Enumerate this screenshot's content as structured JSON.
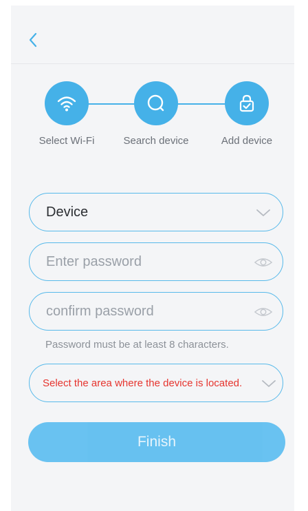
{
  "header": {
    "back_icon": "chevron-left-icon"
  },
  "steps": [
    {
      "label": "Select Wi-Fi",
      "icon": "wifi-icon"
    },
    {
      "label": "Search device",
      "icon": "search-icon"
    },
    {
      "label": "Add device",
      "icon": "lock-check-icon"
    }
  ],
  "form": {
    "device": {
      "value": "Device",
      "icon": "chevron-down-icon"
    },
    "password": {
      "placeholder": "Enter password",
      "icon": "eye-icon"
    },
    "confirm_password": {
      "placeholder": "confirm password",
      "icon": "eye-icon"
    },
    "hint": "Password must be at least 8 characters.",
    "area": {
      "placeholder": "Select the area where the device is located.",
      "icon": "chevron-down-icon"
    },
    "finish_label": "Finish"
  },
  "colors": {
    "accent": "#45b1e8",
    "warning": "#e6342e",
    "background": "#f4f5f7"
  }
}
